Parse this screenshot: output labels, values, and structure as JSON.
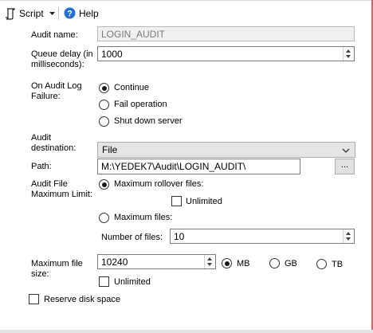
{
  "toolbar": {
    "script_label": "Script",
    "help_label": "Help",
    "script_icon": "script-icon",
    "help_icon": "help-icon"
  },
  "form": {
    "audit_name": {
      "label": "Audit name:",
      "value": "LOGIN_AUDIT"
    },
    "queue_delay": {
      "label": "Queue delay (in milliseconds):",
      "value": "1000"
    },
    "on_failure": {
      "label": "On Audit Log Failure:",
      "options": [
        "Continue",
        "Fail operation",
        "Shut down server"
      ],
      "selected": "Continue"
    },
    "destination": {
      "label": "Audit destination:",
      "value": "File"
    },
    "path": {
      "label": "Path:",
      "value": "M:\\YEDEK7\\Audit\\LOGIN_AUDIT\\",
      "browse_label": "..."
    },
    "max_limit": {
      "label": "Audit File Maximum Limit:",
      "rollover_label": "Maximum rollover files:",
      "unlimited_label": "Unlimited",
      "unlimited_checked": false,
      "max_files_label": "Maximum files:",
      "selected": "Maximum rollover files:",
      "num_files_label": "Number of files:",
      "num_files_value": "10"
    },
    "max_file_size": {
      "label": "Maximum file size:",
      "value": "10240",
      "units": [
        "MB",
        "GB",
        "TB"
      ],
      "selected_unit": "MB",
      "unlimited_label": "Unlimited",
      "unlimited_checked": false
    },
    "reserve_disk_space": {
      "label": "Reserve disk space",
      "checked": false
    }
  },
  "colors": {
    "help_icon_bg": "#1e6fd9",
    "accent_border": "#e06060"
  }
}
